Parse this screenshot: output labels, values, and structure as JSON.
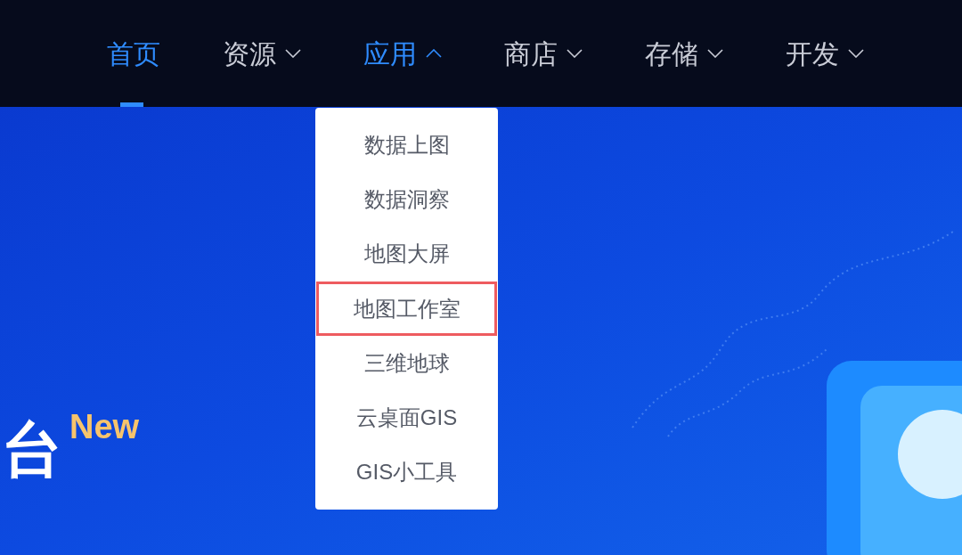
{
  "nav": [
    {
      "label": "首页",
      "kind": "plain",
      "selected": true
    },
    {
      "label": "资源",
      "kind": "dropdown",
      "selected": false,
      "expanded": false
    },
    {
      "label": "应用",
      "kind": "dropdown",
      "selected": false,
      "expanded": true
    },
    {
      "label": "商店",
      "kind": "dropdown",
      "selected": false,
      "expanded": false
    },
    {
      "label": "存储",
      "kind": "dropdown",
      "selected": false,
      "expanded": false
    },
    {
      "label": "开发",
      "kind": "dropdown",
      "selected": false,
      "expanded": false
    }
  ],
  "dropdown": {
    "items": [
      {
        "label": "数据上图",
        "selected": false
      },
      {
        "label": "数据洞察",
        "selected": false
      },
      {
        "label": "地图大屏",
        "selected": false
      },
      {
        "label": "地图工作室",
        "selected": true
      },
      {
        "label": "三维地球",
        "selected": false
      },
      {
        "label": "云桌面GIS",
        "selected": false
      },
      {
        "label": "GIS小工具",
        "selected": false
      }
    ]
  },
  "hero": {
    "title": "台",
    "badge": "New"
  }
}
